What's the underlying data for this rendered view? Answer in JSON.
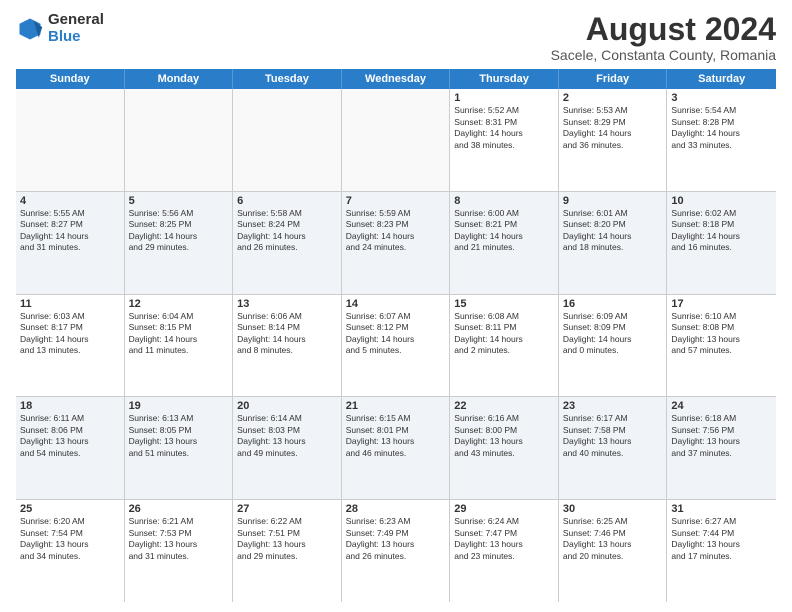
{
  "logo": {
    "general": "General",
    "blue": "Blue"
  },
  "title": "August 2024",
  "subtitle": "Sacele, Constanta County, Romania",
  "days": [
    "Sunday",
    "Monday",
    "Tuesday",
    "Wednesday",
    "Thursday",
    "Friday",
    "Saturday"
  ],
  "weeks": [
    [
      {
        "day": "",
        "info": ""
      },
      {
        "day": "",
        "info": ""
      },
      {
        "day": "",
        "info": ""
      },
      {
        "day": "",
        "info": ""
      },
      {
        "day": "1",
        "info": "Sunrise: 5:52 AM\nSunset: 8:31 PM\nDaylight: 14 hours\nand 38 minutes."
      },
      {
        "day": "2",
        "info": "Sunrise: 5:53 AM\nSunset: 8:29 PM\nDaylight: 14 hours\nand 36 minutes."
      },
      {
        "day": "3",
        "info": "Sunrise: 5:54 AM\nSunset: 8:28 PM\nDaylight: 14 hours\nand 33 minutes."
      }
    ],
    [
      {
        "day": "4",
        "info": "Sunrise: 5:55 AM\nSunset: 8:27 PM\nDaylight: 14 hours\nand 31 minutes."
      },
      {
        "day": "5",
        "info": "Sunrise: 5:56 AM\nSunset: 8:25 PM\nDaylight: 14 hours\nand 29 minutes."
      },
      {
        "day": "6",
        "info": "Sunrise: 5:58 AM\nSunset: 8:24 PM\nDaylight: 14 hours\nand 26 minutes."
      },
      {
        "day": "7",
        "info": "Sunrise: 5:59 AM\nSunset: 8:23 PM\nDaylight: 14 hours\nand 24 minutes."
      },
      {
        "day": "8",
        "info": "Sunrise: 6:00 AM\nSunset: 8:21 PM\nDaylight: 14 hours\nand 21 minutes."
      },
      {
        "day": "9",
        "info": "Sunrise: 6:01 AM\nSunset: 8:20 PM\nDaylight: 14 hours\nand 18 minutes."
      },
      {
        "day": "10",
        "info": "Sunrise: 6:02 AM\nSunset: 8:18 PM\nDaylight: 14 hours\nand 16 minutes."
      }
    ],
    [
      {
        "day": "11",
        "info": "Sunrise: 6:03 AM\nSunset: 8:17 PM\nDaylight: 14 hours\nand 13 minutes."
      },
      {
        "day": "12",
        "info": "Sunrise: 6:04 AM\nSunset: 8:15 PM\nDaylight: 14 hours\nand 11 minutes."
      },
      {
        "day": "13",
        "info": "Sunrise: 6:06 AM\nSunset: 8:14 PM\nDaylight: 14 hours\nand 8 minutes."
      },
      {
        "day": "14",
        "info": "Sunrise: 6:07 AM\nSunset: 8:12 PM\nDaylight: 14 hours\nand 5 minutes."
      },
      {
        "day": "15",
        "info": "Sunrise: 6:08 AM\nSunset: 8:11 PM\nDaylight: 14 hours\nand 2 minutes."
      },
      {
        "day": "16",
        "info": "Sunrise: 6:09 AM\nSunset: 8:09 PM\nDaylight: 14 hours\nand 0 minutes."
      },
      {
        "day": "17",
        "info": "Sunrise: 6:10 AM\nSunset: 8:08 PM\nDaylight: 13 hours\nand 57 minutes."
      }
    ],
    [
      {
        "day": "18",
        "info": "Sunrise: 6:11 AM\nSunset: 8:06 PM\nDaylight: 13 hours\nand 54 minutes."
      },
      {
        "day": "19",
        "info": "Sunrise: 6:13 AM\nSunset: 8:05 PM\nDaylight: 13 hours\nand 51 minutes."
      },
      {
        "day": "20",
        "info": "Sunrise: 6:14 AM\nSunset: 8:03 PM\nDaylight: 13 hours\nand 49 minutes."
      },
      {
        "day": "21",
        "info": "Sunrise: 6:15 AM\nSunset: 8:01 PM\nDaylight: 13 hours\nand 46 minutes."
      },
      {
        "day": "22",
        "info": "Sunrise: 6:16 AM\nSunset: 8:00 PM\nDaylight: 13 hours\nand 43 minutes."
      },
      {
        "day": "23",
        "info": "Sunrise: 6:17 AM\nSunset: 7:58 PM\nDaylight: 13 hours\nand 40 minutes."
      },
      {
        "day": "24",
        "info": "Sunrise: 6:18 AM\nSunset: 7:56 PM\nDaylight: 13 hours\nand 37 minutes."
      }
    ],
    [
      {
        "day": "25",
        "info": "Sunrise: 6:20 AM\nSunset: 7:54 PM\nDaylight: 13 hours\nand 34 minutes."
      },
      {
        "day": "26",
        "info": "Sunrise: 6:21 AM\nSunset: 7:53 PM\nDaylight: 13 hours\nand 31 minutes."
      },
      {
        "day": "27",
        "info": "Sunrise: 6:22 AM\nSunset: 7:51 PM\nDaylight: 13 hours\nand 29 minutes."
      },
      {
        "day": "28",
        "info": "Sunrise: 6:23 AM\nSunset: 7:49 PM\nDaylight: 13 hours\nand 26 minutes."
      },
      {
        "day": "29",
        "info": "Sunrise: 6:24 AM\nSunset: 7:47 PM\nDaylight: 13 hours\nand 23 minutes."
      },
      {
        "day": "30",
        "info": "Sunrise: 6:25 AM\nSunset: 7:46 PM\nDaylight: 13 hours\nand 20 minutes."
      },
      {
        "day": "31",
        "info": "Sunrise: 6:27 AM\nSunset: 7:44 PM\nDaylight: 13 hours\nand 17 minutes."
      }
    ]
  ]
}
